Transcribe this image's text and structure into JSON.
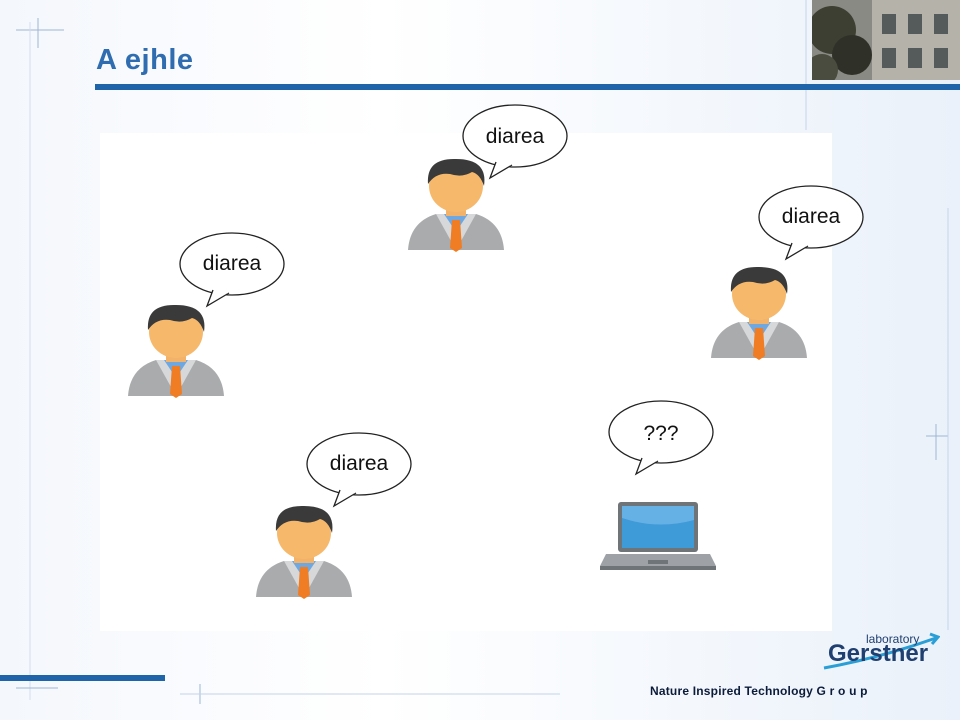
{
  "slide": {
    "title": "A ejhle"
  },
  "bubbles": [
    {
      "text": "diarea"
    },
    {
      "text": "diarea"
    },
    {
      "text": "diarea"
    },
    {
      "text": "diarea"
    },
    {
      "text": "???"
    }
  ],
  "footer": {
    "tagline": "Nature Inspired Technology  G r o u p"
  },
  "logo": {
    "small": "laboratory",
    "name": "Gerstner"
  },
  "colors": {
    "accent": "#1f63a8",
    "title": "#2f6db0"
  }
}
